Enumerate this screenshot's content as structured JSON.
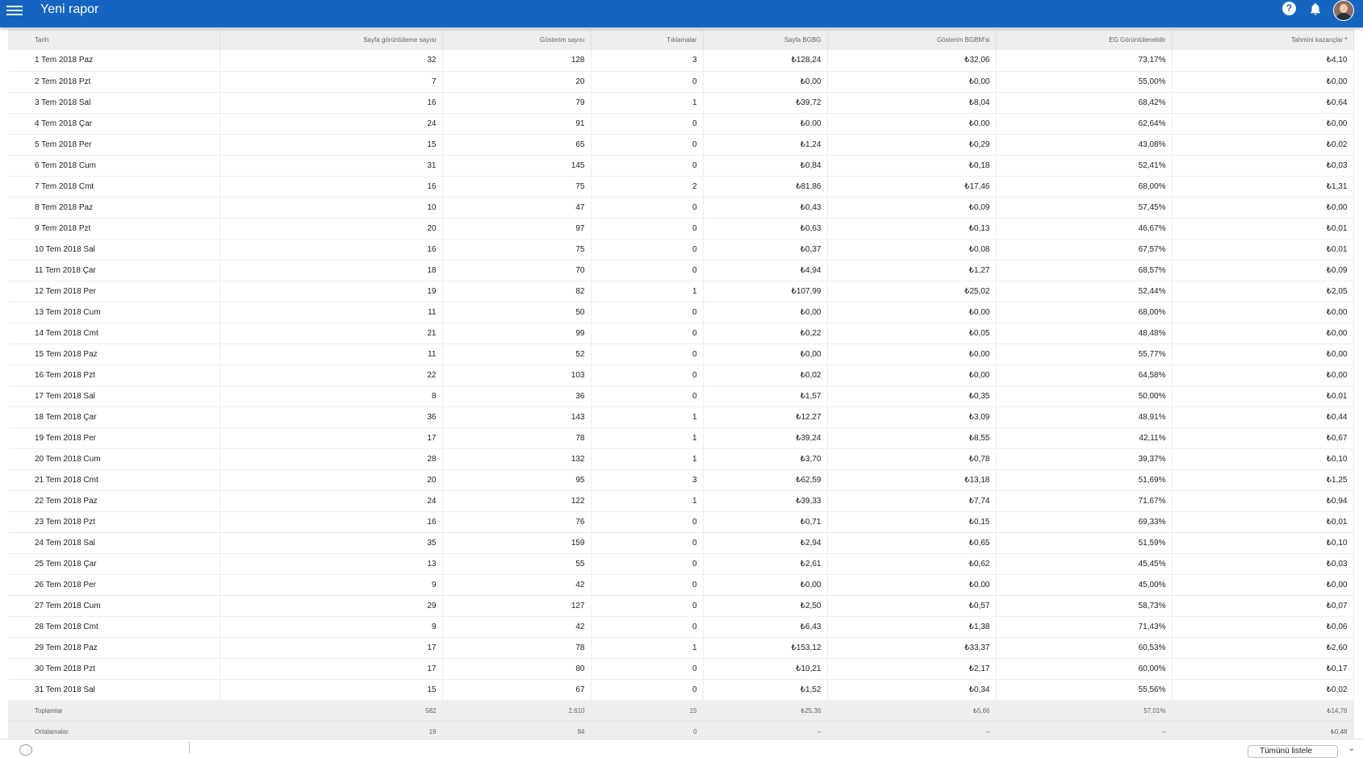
{
  "header": {
    "title": "Yeni rapor",
    "menu_icon": "menu-icon",
    "help_icon": "help-icon",
    "notifications_icon": "bell-icon",
    "avatar_icon": "avatar",
    "brand_color": "#1565c0"
  },
  "table": {
    "columns": [
      "Tarih",
      "Sayfa görüntüleme sayısı",
      "Gösterim sayısı",
      "Tıklamalar",
      "Sayfa BGBG",
      "Gösterim BGBM'si",
      "EG Görüntülenebilir",
      "Tahmini kazançlar *"
    ],
    "rows": [
      [
        "1 Tem 2018 Paz",
        "32",
        "128",
        "3",
        "₺128,24",
        "₺32,06",
        "73,17%",
        "₺4,10"
      ],
      [
        "2 Tem 2018 Pzt",
        "7",
        "20",
        "0",
        "₺0,00",
        "₺0,00",
        "55,00%",
        "₺0,00"
      ],
      [
        "3 Tem 2018 Sal",
        "16",
        "79",
        "1",
        "₺39,72",
        "₺8,04",
        "68,42%",
        "₺0,64"
      ],
      [
        "4 Tem 2018 Çar",
        "24",
        "91",
        "0",
        "₺0,00",
        "₺0,00",
        "62,64%",
        "₺0,00"
      ],
      [
        "5 Tem 2018 Per",
        "15",
        "65",
        "0",
        "₺1,24",
        "₺0,29",
        "43,08%",
        "₺0,02"
      ],
      [
        "6 Tem 2018 Cum",
        "31",
        "145",
        "0",
        "₺0,84",
        "₺0,18",
        "52,41%",
        "₺0,03"
      ],
      [
        "7 Tem 2018 Cmt",
        "16",
        "75",
        "2",
        "₺81,86",
        "₺17,46",
        "68,00%",
        "₺1,31"
      ],
      [
        "8 Tem 2018 Paz",
        "10",
        "47",
        "0",
        "₺0,43",
        "₺0,09",
        "57,45%",
        "₺0,00"
      ],
      [
        "9 Tem 2018 Pzt",
        "20",
        "97",
        "0",
        "₺0,63",
        "₺0,13",
        "46,67%",
        "₺0,01"
      ],
      [
        "10 Tem 2018 Sal",
        "16",
        "75",
        "0",
        "₺0,37",
        "₺0,08",
        "67,57%",
        "₺0,01"
      ],
      [
        "11 Tem 2018 Çar",
        "18",
        "70",
        "0",
        "₺4,94",
        "₺1,27",
        "68,57%",
        "₺0,09"
      ],
      [
        "12 Tem 2018 Per",
        "19",
        "82",
        "1",
        "₺107,99",
        "₺25,02",
        "52,44%",
        "₺2,05"
      ],
      [
        "13 Tem 2018 Cum",
        "11",
        "50",
        "0",
        "₺0,00",
        "₺0,00",
        "68,00%",
        "₺0,00"
      ],
      [
        "14 Tem 2018 Cmt",
        "21",
        "99",
        "0",
        "₺0,22",
        "₺0,05",
        "48,48%",
        "₺0,00"
      ],
      [
        "15 Tem 2018 Paz",
        "11",
        "52",
        "0",
        "₺0,00",
        "₺0,00",
        "55,77%",
        "₺0,00"
      ],
      [
        "16 Tem 2018 Pzt",
        "22",
        "103",
        "0",
        "₺0,02",
        "₺0,00",
        "64,58%",
        "₺0,00"
      ],
      [
        "17 Tem 2018 Sal",
        "8",
        "36",
        "0",
        "₺1,57",
        "₺0,35",
        "50,00%",
        "₺0,01"
      ],
      [
        "18 Tem 2018 Çar",
        "36",
        "143",
        "1",
        "₺12,27",
        "₺3,09",
        "48,91%",
        "₺0,44"
      ],
      [
        "19 Tem 2018 Per",
        "17",
        "78",
        "1",
        "₺39,24",
        "₺8,55",
        "42,11%",
        "₺0,67"
      ],
      [
        "20 Tem 2018 Cum",
        "28",
        "132",
        "1",
        "₺3,70",
        "₺0,78",
        "39,37%",
        "₺0,10"
      ],
      [
        "21 Tem 2018 Cmt",
        "20",
        "95",
        "3",
        "₺62,59",
        "₺13,18",
        "51,69%",
        "₺1,25"
      ],
      [
        "22 Tem 2018 Paz",
        "24",
        "122",
        "1",
        "₺39,33",
        "₺7,74",
        "71,67%",
        "₺0,94"
      ],
      [
        "23 Tem 2018 Pzt",
        "16",
        "76",
        "0",
        "₺0,71",
        "₺0,15",
        "69,33%",
        "₺0,01"
      ],
      [
        "24 Tem 2018 Sal",
        "35",
        "159",
        "0",
        "₺2,94",
        "₺0,65",
        "51,59%",
        "₺0,10"
      ],
      [
        "25 Tem 2018 Çar",
        "13",
        "55",
        "0",
        "₺2,61",
        "₺0,62",
        "45,45%",
        "₺0,03"
      ],
      [
        "26 Tem 2018 Per",
        "9",
        "42",
        "0",
        "₺0,00",
        "₺0,00",
        "45,00%",
        "₺0,00"
      ],
      [
        "27 Tem 2018 Cum",
        "29",
        "127",
        "0",
        "₺2,50",
        "₺0,57",
        "58,73%",
        "₺0,07"
      ],
      [
        "28 Tem 2018 Cmt",
        "9",
        "42",
        "0",
        "₺6,43",
        "₺1,38",
        "71,43%",
        "₺0,06"
      ],
      [
        "29 Tem 2018 Paz",
        "17",
        "78",
        "1",
        "₺153,12",
        "₺33,37",
        "60,53%",
        "₺2,60"
      ],
      [
        "30 Tem 2018 Pzt",
        "17",
        "80",
        "0",
        "₺10,21",
        "₺2,17",
        "60,00%",
        "₺0,17"
      ],
      [
        "31 Tem 2018 Sal",
        "15",
        "67",
        "0",
        "₺1,52",
        "₺0,34",
        "55,56%",
        "₺0,02"
      ]
    ],
    "totals": [
      "Toplamlar",
      "582",
      "2.610",
      "15",
      "₺25,36",
      "₺5,66",
      "57,01%",
      "₺14,76"
    ],
    "averages": [
      "Ortalamalar",
      "19",
      "84",
      "0",
      "–",
      "–",
      "–",
      "₺0,48"
    ]
  },
  "footer": {
    "button_label": "Tümünü listele",
    "more_label": "⌄"
  }
}
